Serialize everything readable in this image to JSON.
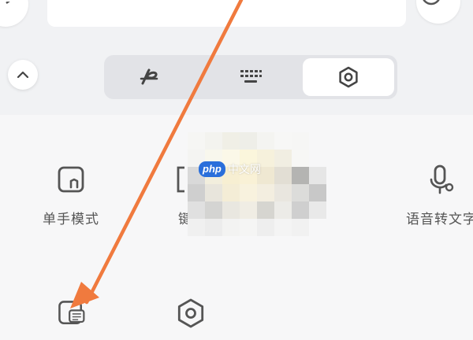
{
  "features": [
    {
      "label": "单手模式",
      "icon": "one-hand-mode-icon"
    },
    {
      "label": "键盘",
      "icon": "keyboard-resize-icon"
    },
    {
      "label": "语音转文字",
      "icon": "voice-to-text-icon"
    }
  ],
  "bottom_row": [
    {
      "icon": "clipboard-icon"
    },
    {
      "icon": "settings-hexagon-icon"
    }
  ],
  "mode_tabs": [
    {
      "icon": "handwriting-icon",
      "active": false
    },
    {
      "icon": "keyboard-icon",
      "active": false
    },
    {
      "icon": "settings-hexagon-icon",
      "active": true
    }
  ],
  "watermark": {
    "badge": "php",
    "text": "中文网"
  },
  "colors": {
    "arrow": "#f07a3e",
    "accent": "#2a6fdb",
    "icon": "#555555"
  }
}
